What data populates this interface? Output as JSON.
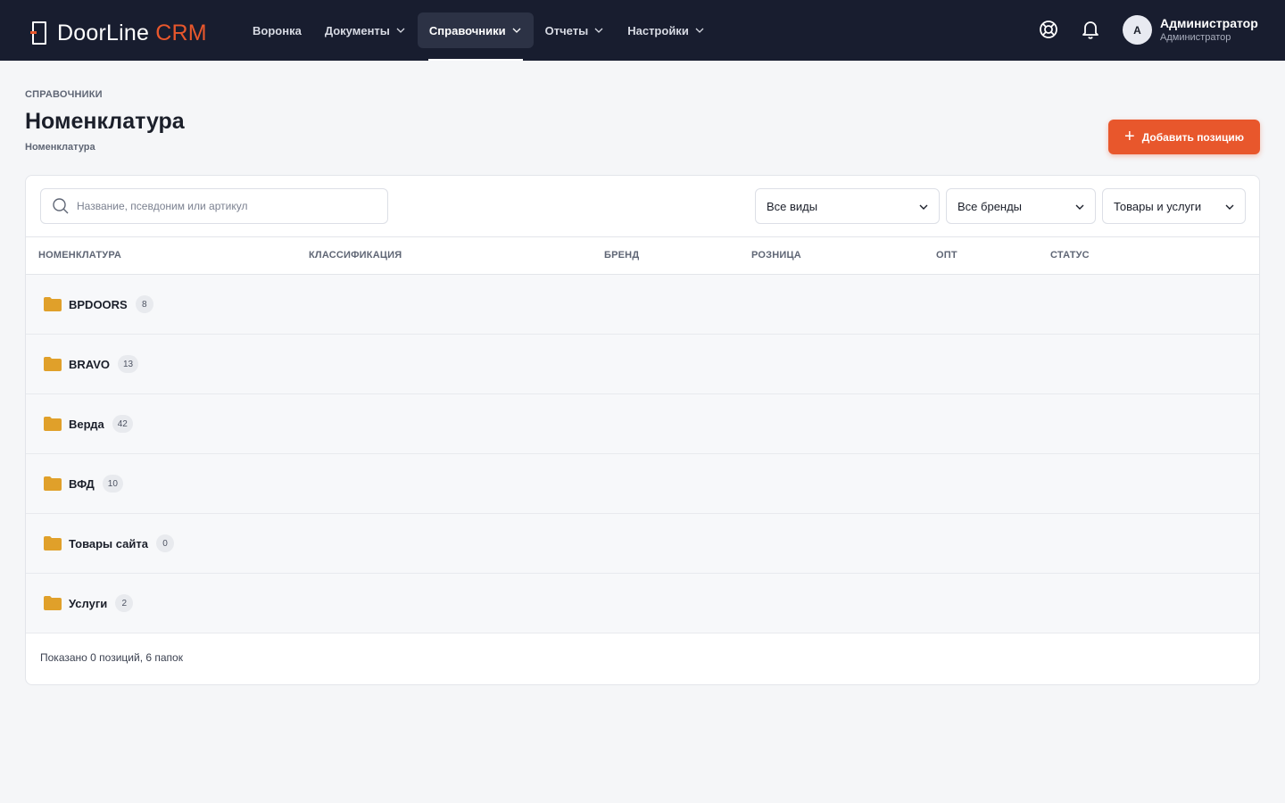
{
  "app": {
    "logo_main": "DoorLine",
    "logo_accent": "CRM"
  },
  "nav": {
    "items": [
      {
        "label": "Воронка"
      },
      {
        "label": "Документы"
      },
      {
        "label": "Справочники"
      },
      {
        "label": "Отчеты"
      },
      {
        "label": "Настройки"
      }
    ]
  },
  "user": {
    "initial": "A",
    "name": "Администратор",
    "role": "Администратор"
  },
  "page": {
    "eyebrow": "СПРАВОЧНИКИ",
    "title": "Номенклатура",
    "breadcrumb": "Номенклатура",
    "add_button": "Добавить позицию"
  },
  "filters": {
    "search_placeholder": "Название, псевдоним или артикул",
    "type_select": "Все виды",
    "brand_select": "Все бренды",
    "category_select": "Товары и услуги"
  },
  "table": {
    "columns": [
      "НОМЕНКЛАТУРА",
      "КЛАССИФИКАЦИЯ",
      "БРЕНД",
      "РОЗНИЦА",
      "ОПТ",
      "СТАТУС"
    ],
    "folders": [
      {
        "name": "BPDOORS",
        "count": "8"
      },
      {
        "name": "BRAVO",
        "count": "13"
      },
      {
        "name": "Верда",
        "count": "42"
      },
      {
        "name": "ВФД",
        "count": "10"
      },
      {
        "name": "Товары сайта",
        "count": "0"
      },
      {
        "name": "Услуги",
        "count": "2"
      }
    ],
    "summary": "Показано 0 позиций, 6 папок"
  },
  "colors": {
    "accent": "#e8572c",
    "topbar": "#181d2f",
    "folder": "#e0a02a"
  }
}
